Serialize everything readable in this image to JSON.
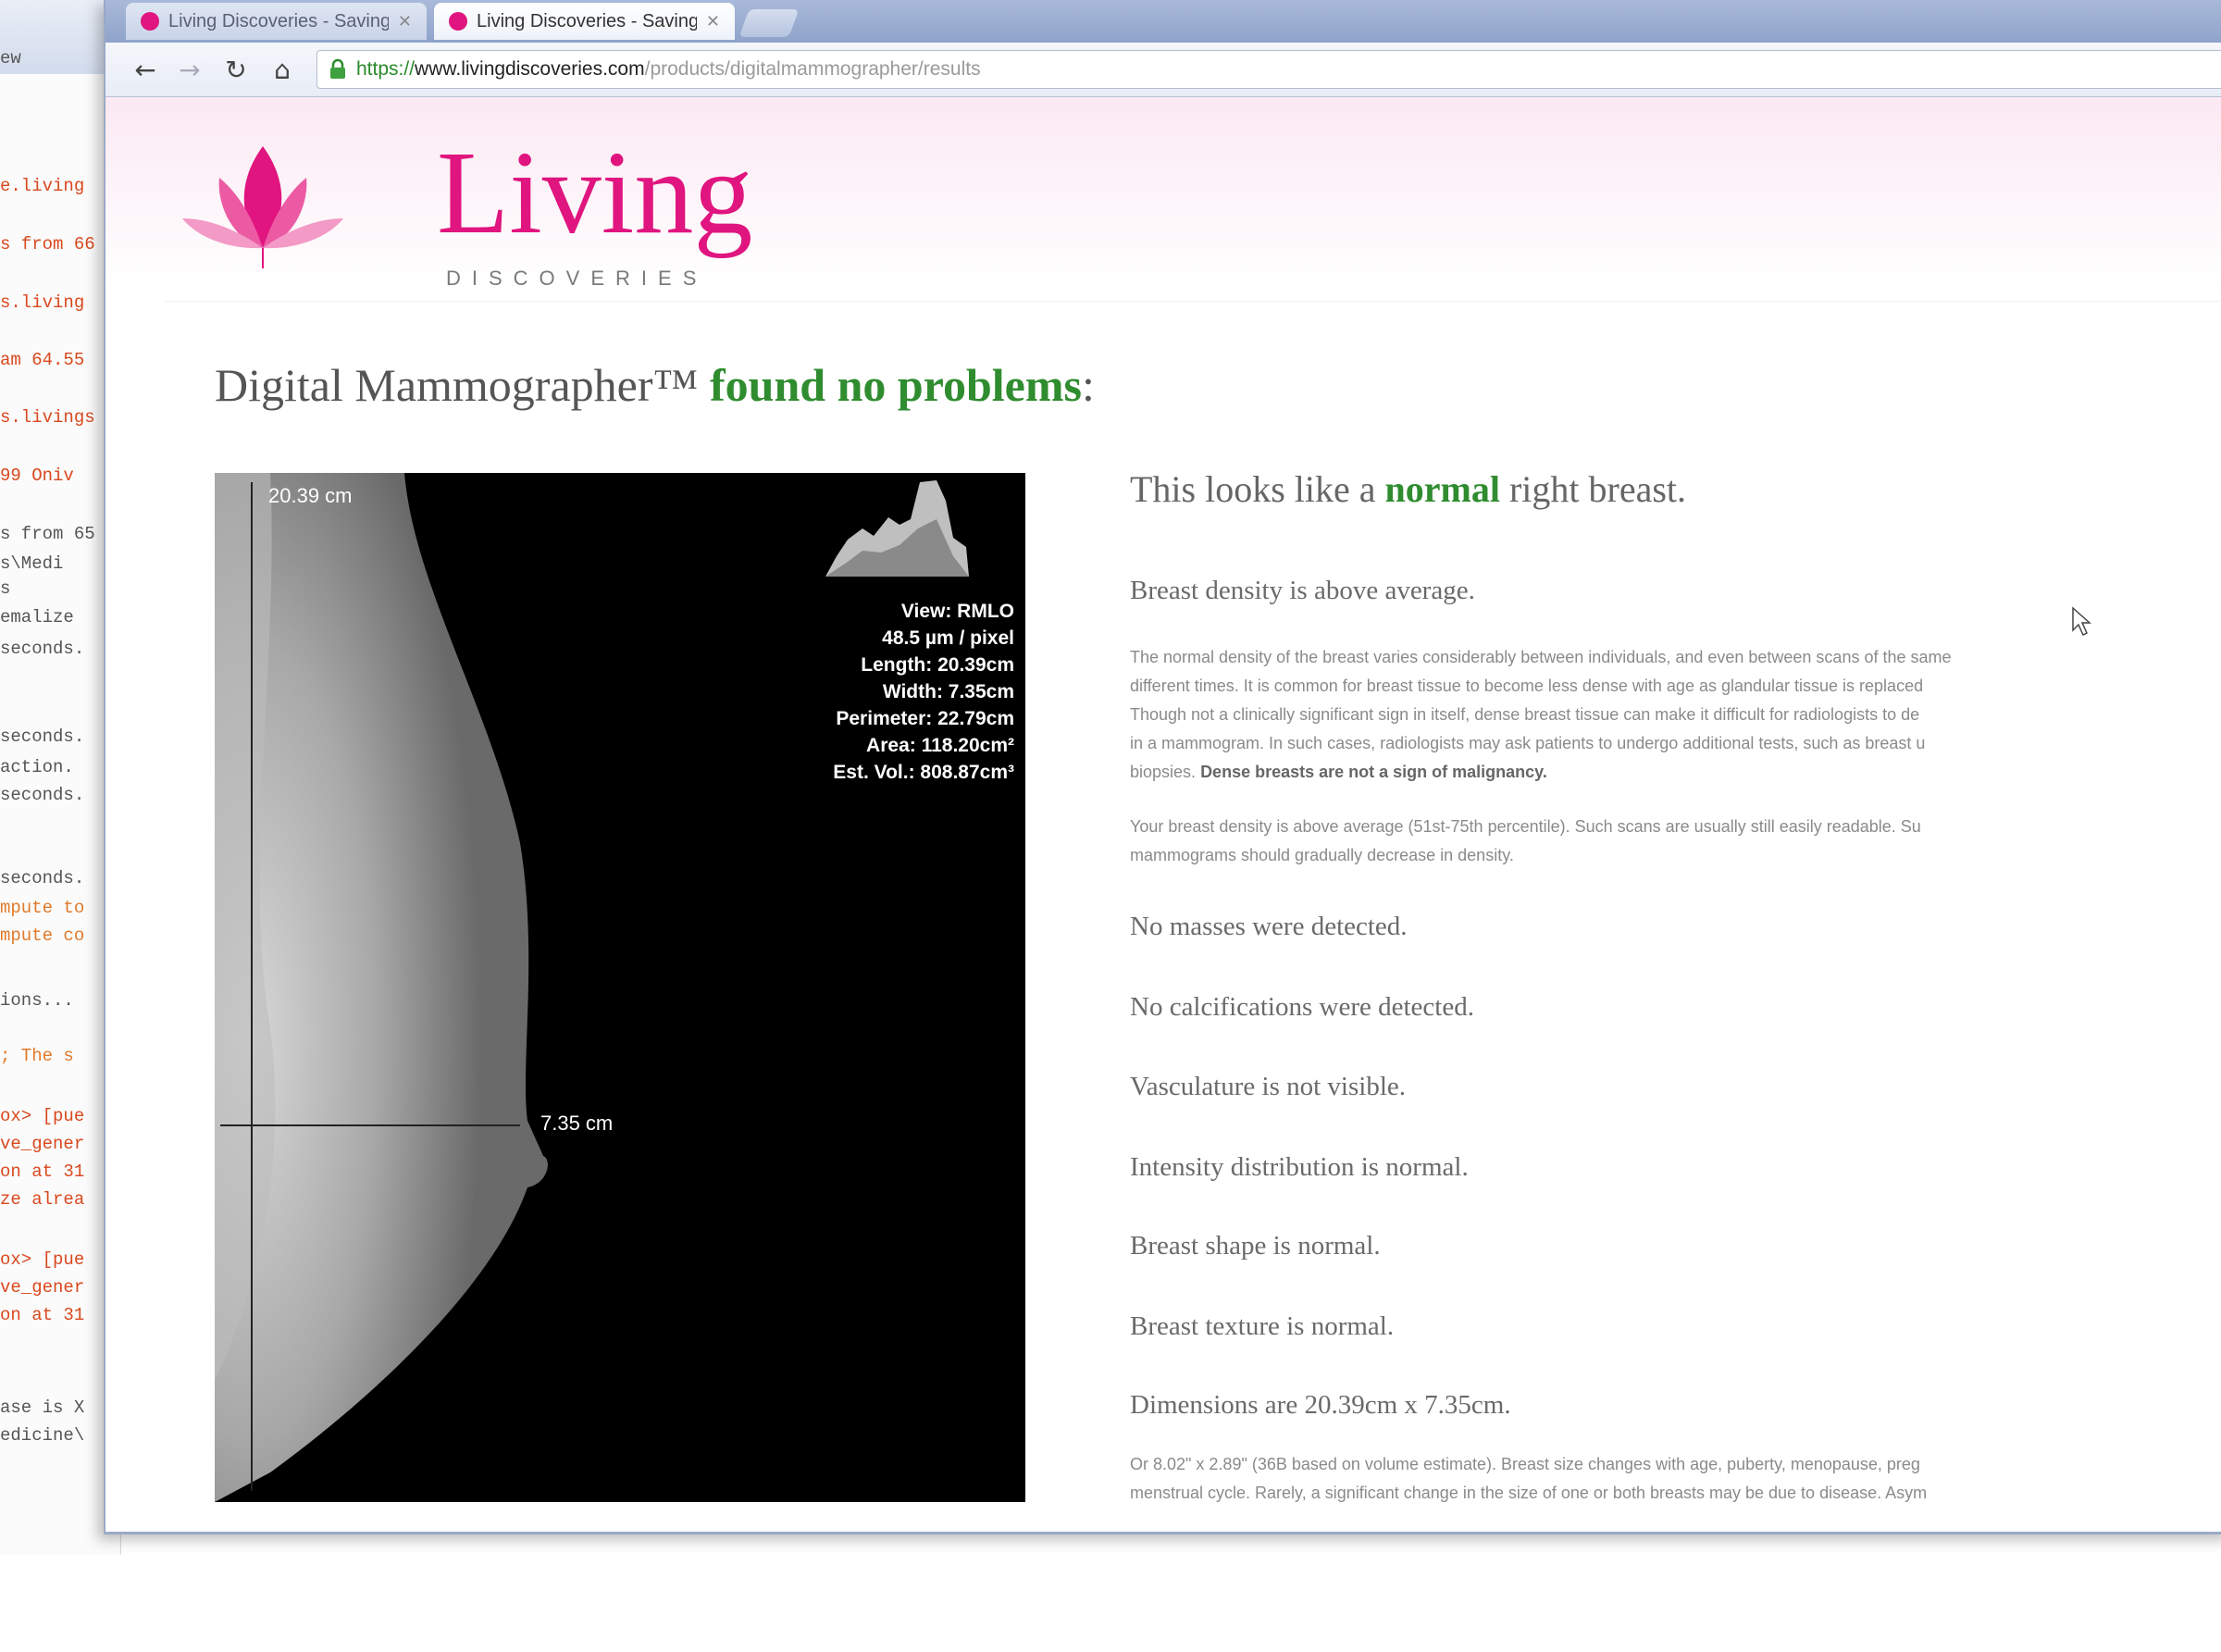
{
  "background_terminal": {
    "lines": [
      {
        "text": "ew",
        "tone": "dark"
      },
      {
        "text": "e.living",
        "tone": "red"
      },
      {
        "text": "s from 66",
        "tone": "red"
      },
      {
        "text": "s.living",
        "tone": "red"
      },
      {
        "text": "am 64.55",
        "tone": "red"
      },
      {
        "text": "s.livings",
        "tone": "red"
      },
      {
        "text": "99 Oniv",
        "tone": "red"
      },
      {
        "text": "s from 65",
        "tone": "dark"
      },
      {
        "text": "s\\Medi",
        "tone": "dark"
      },
      {
        "text": "s",
        "tone": "dark"
      },
      {
        "text": "emalize",
        "tone": "dark"
      },
      {
        "text": "seconds.",
        "tone": "dark"
      },
      {
        "text": "seconds.",
        "tone": "dark"
      },
      {
        "text": "action.",
        "tone": "dark"
      },
      {
        "text": "seconds.",
        "tone": "dark"
      },
      {
        "text": "seconds.",
        "tone": "dark"
      },
      {
        "text": "mpute to",
        "tone": "orange"
      },
      {
        "text": "mpute co",
        "tone": "orange"
      },
      {
        "text": "ions...",
        "tone": "dark"
      },
      {
        "text": "; The s",
        "tone": "orange"
      },
      {
        "text": "ox> [pue",
        "tone": "red"
      },
      {
        "text": "ve_gener",
        "tone": "red"
      },
      {
        "text": "on at 31",
        "tone": "red"
      },
      {
        "text": "ze alrea",
        "tone": "red"
      },
      {
        "text": "ox> [pue",
        "tone": "red"
      },
      {
        "text": "ve_gener",
        "tone": "red"
      },
      {
        "text": "on at 31",
        "tone": "red"
      },
      {
        "text": "ase is X",
        "tone": "dark"
      },
      {
        "text": "edicine\\",
        "tone": "dark"
      }
    ]
  },
  "browser": {
    "tabs": [
      {
        "title": "Living Discoveries - Saving",
        "active": false
      },
      {
        "title": "Living Discoveries - Saving",
        "active": true
      }
    ],
    "url": {
      "scheme": "https://",
      "host": "www.livingdiscoveries.com",
      "path": "/products/digitalmammographer/results"
    }
  },
  "logo": {
    "word": "Living",
    "sub": "DISCOVERIES"
  },
  "headline": {
    "prefix": "Digital Mammographer™ ",
    "status": "found no problems",
    "suffix": ":"
  },
  "xray": {
    "height_label": "20.39 cm",
    "width_label": "7.35 cm",
    "meta": [
      "View: RMLO",
      "48.5 µm / pixel",
      "Length: 20.39cm",
      "Width: 7.35cm",
      "Perimeter: 22.79cm",
      "Area: 118.20cm²",
      "Est. Vol.: 808.87cm³"
    ]
  },
  "results": {
    "lead": {
      "prefix": "This looks like a ",
      "highlight": "normal",
      "suffix": " right breast."
    },
    "density_title": "Breast density is above average.",
    "density_para": [
      "The normal density of the breast varies considerably between individuals, and even between scans of the same",
      "different times. It is common for breast tissue to become less dense with age as glandular tissue is replaced",
      "Though not a clinically significant sign in itself, dense breast tissue can make it difficult for radiologists to de",
      "in a mammogram. In such cases, radiologists may ask patients to undergo additional tests, such as breast u",
      "biopsies."
    ],
    "density_para_bold": "Dense breasts are not a sign of malignancy.",
    "density_note": [
      "Your breast density is above average (51st-75th percentile). Such scans are usually still easily readable. Su",
      "mammograms should gradually decrease in density."
    ],
    "findings": [
      "No masses were detected.",
      "No calcifications were detected.",
      "Vasculature is not visible.",
      "Intensity distribution is normal.",
      "Breast shape is normal.",
      "Breast texture is normal.",
      "Dimensions are 20.39cm x 7.35cm."
    ],
    "dimensions_note": [
      "Or 8.02\" x 2.89\" (36B based on volume estimate). Breast size changes with age, puberty, menopause, preg",
      "menstrual cycle. Rarely, a significant change in the size of one or both breasts may be due to disease. Asym"
    ]
  }
}
